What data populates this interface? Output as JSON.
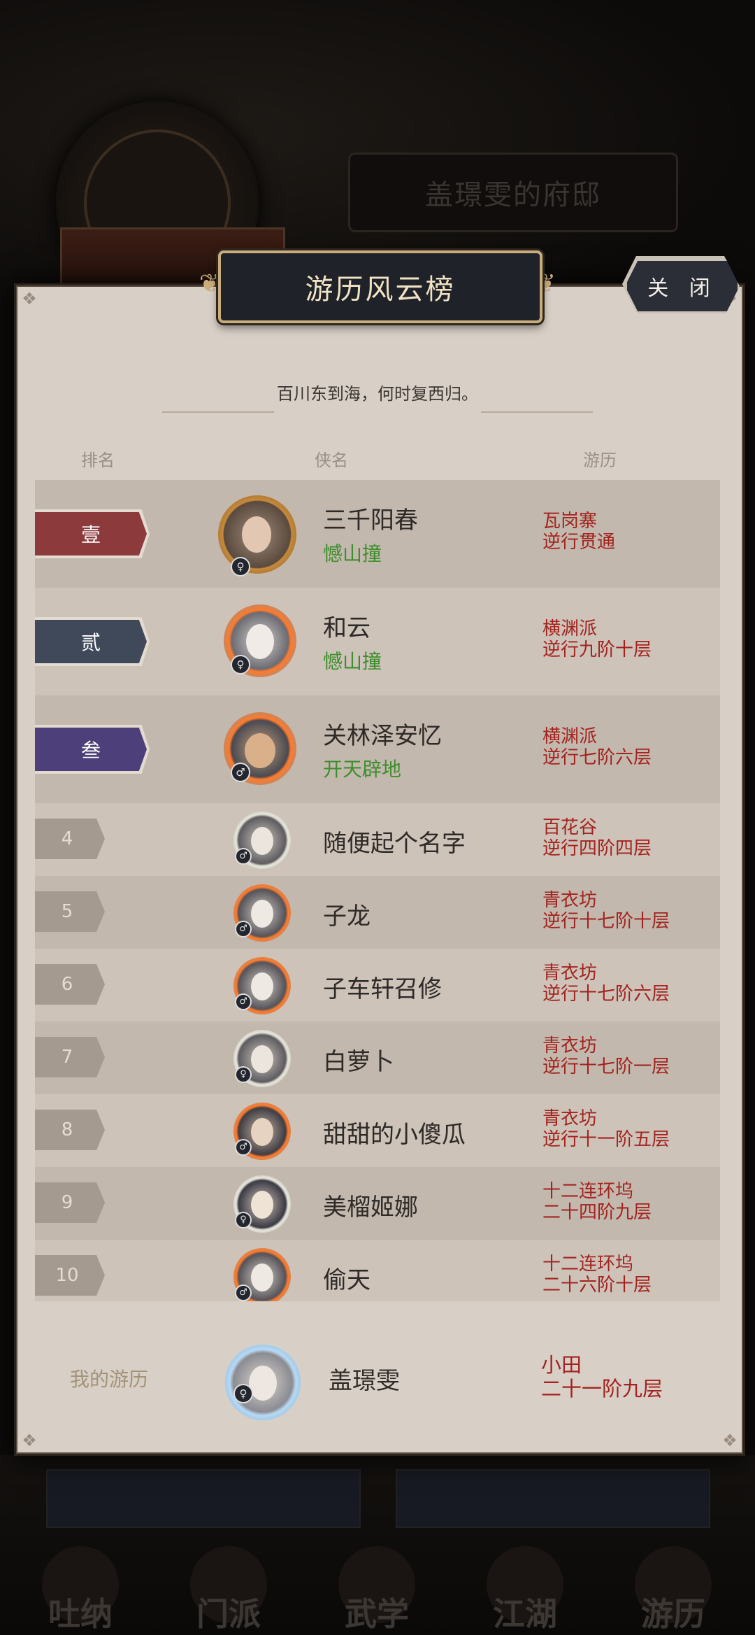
{
  "background": {
    "house_title": "盖璟雯的府邸",
    "nav": [
      "吐纳",
      "门派",
      "武学",
      "江湖",
      "游历"
    ]
  },
  "dialog": {
    "title": "游历风云榜",
    "close_label": "关 闭",
    "subtitle": "百川东到海，何时复西归。",
    "columns": {
      "rank": "排名",
      "name": "侠名",
      "travel": "游历"
    }
  },
  "rankings": [
    {
      "rank": "壹",
      "name": "三千阳春",
      "skill": "憾山撞",
      "sect": "瓦岗寨",
      "level": "逆行贯通",
      "gender": "♀",
      "rank_color": "#8c3a3c"
    },
    {
      "rank": "贰",
      "name": "和云",
      "skill": "憾山撞",
      "sect": "横渊派",
      "level": "逆行九阶十层",
      "gender": "♀",
      "rank_color": "#40495a"
    },
    {
      "rank": "叁",
      "name": "关林泽安忆",
      "skill": "开天辟地",
      "sect": "横渊派",
      "level": "逆行七阶六层",
      "gender": "♂",
      "rank_color": "#4c3f7a"
    },
    {
      "rank": "4",
      "name": "随便起个名字",
      "sect": "百花谷",
      "level": "逆行四阶四层",
      "gender": "♂"
    },
    {
      "rank": "5",
      "name": "子龙",
      "sect": "青衣坊",
      "level": "逆行十七阶十层",
      "gender": "♂"
    },
    {
      "rank": "6",
      "name": "子车轩召修",
      "sect": "青衣坊",
      "level": "逆行十七阶六层",
      "gender": "♂"
    },
    {
      "rank": "7",
      "name": "白萝卜",
      "sect": "青衣坊",
      "level": "逆行十七阶一层",
      "gender": "♀"
    },
    {
      "rank": "8",
      "name": "甜甜的小傻瓜",
      "sect": "青衣坊",
      "level": "逆行十一阶五层",
      "gender": "♂"
    },
    {
      "rank": "9",
      "name": "美榴姬娜",
      "sect": "十二连环坞",
      "level": "二十四阶九层",
      "gender": "♀"
    },
    {
      "rank": "10",
      "name": "偷天",
      "sect": "十二连环坞",
      "level": "二十六阶十层",
      "gender": "♂"
    }
  ],
  "mine": {
    "label": "我的游历",
    "name": "盖璟雯",
    "sect": "小田",
    "level": "二十一阶九层",
    "gender": "♀"
  }
}
